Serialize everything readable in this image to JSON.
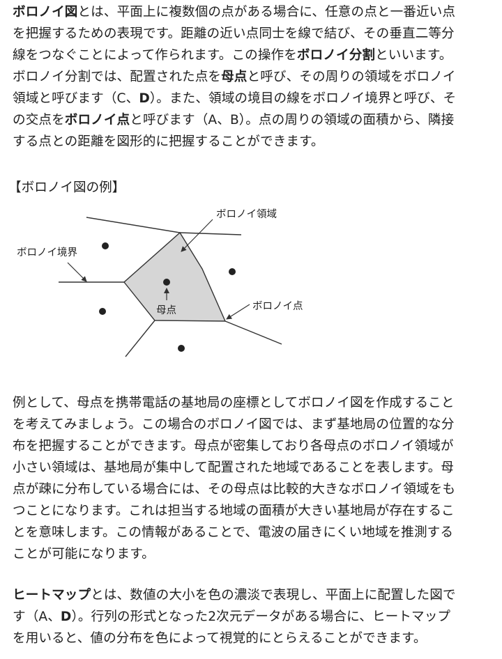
{
  "paragraph1": {
    "l1": {
      "b1": "ボロノイ図",
      "t1": "とは、平面上に複数個の点がある場合に、任意の点と一番近い点"
    },
    "l2": "を把握するための表現です。距離の近い点同士を線で結び、その垂直二等分",
    "l3": {
      "t1": "線をつなぐことによって作られます。この操作を",
      "b1": "ボロノイ分割",
      "t2": "といいます。"
    },
    "l4": {
      "t1": "ボロノイ分割では、配置された点を",
      "b1": "母点",
      "t2": "と呼び、その周りの領域をボロノイ"
    },
    "l5": {
      "t1": "領域と呼びます（C、",
      "b1": "D",
      "t2": "）。また、領域の境目の線をボロノイ境界と呼び、そ"
    },
    "l6": {
      "t1": "の交点を",
      "b1": "ボロノイ点",
      "t2": "と呼びます（A、B）。点の周りの領域の面積から、隣接"
    },
    "l7": "する点との距離を図形的に把握することができます。"
  },
  "example_heading": "【ボロノイ図の例】",
  "diagram": {
    "label_region": "ボロノイ領域",
    "label_boundary": "ボロノイ境界",
    "label_point": "ボロノイ点",
    "label_generator": "母点",
    "colors": {
      "region_fill": "#d6d6d6",
      "line": "#333333",
      "dot": "#222222"
    }
  },
  "paragraph2": {
    "l1": "例として、母点を携帯電話の基地局の座標としてボロノイ図を作成すること",
    "l2": "を考えてみましょう。この場合のボロノイ図では、まず基地局の位置的な分",
    "l3": "布を把握することができます。母点が密集しており各母点のボロノイ領域が",
    "l4": "小さい領域は、基地局が集中して配置された地域であることを表します。母",
    "l5": "点が疎に分布している場合には、その母点は比較的大きなボロノイ領域をも",
    "l6": "つことになります。これは担当する地域の面積が大きい基地局が存在するこ",
    "l7": "とを意味します。この情報があることで、電波の届きにくい地域を推測する",
    "l8": "ことが可能になります。"
  },
  "paragraph3": {
    "l1": {
      "b1": "ヒートマップ",
      "t1": "とは、数値の大小を色の濃淡で表現し、平面上に配置した図で"
    },
    "l2": {
      "t1": "す（A、",
      "b1": "D",
      "t2": "）。行列の形式となった2次元データがある場合に、ヒートマップ"
    },
    "l3": "を用いると、値の分布を色によって視覚的にとらえることができます。"
  }
}
